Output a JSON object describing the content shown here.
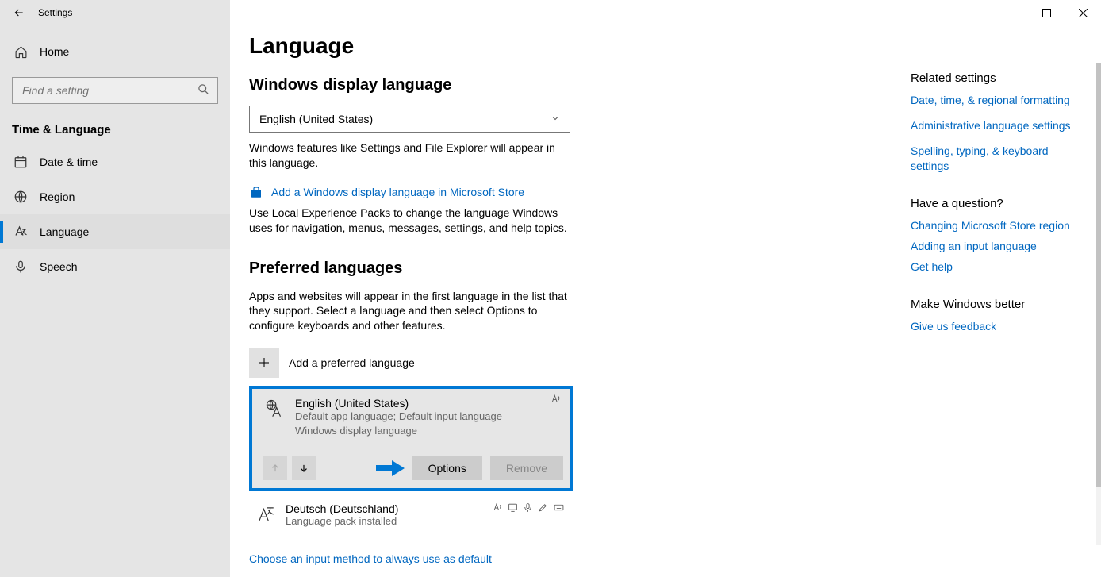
{
  "window": {
    "title": "Settings"
  },
  "sidebar": {
    "home": "Home",
    "search_placeholder": "Find a setting",
    "category": "Time & Language",
    "items": [
      {
        "label": "Date & time"
      },
      {
        "label": "Region"
      },
      {
        "label": "Language"
      },
      {
        "label": "Speech"
      }
    ]
  },
  "main": {
    "page_title": "Language",
    "display_section": {
      "heading": "Windows display language",
      "selected": "English (United States)",
      "desc": "Windows features like Settings and File Explorer will appear in this language.",
      "store_link": "Add a Windows display language in Microsoft Store",
      "store_desc": "Use Local Experience Packs to change the language Windows uses for navigation, menus, messages, settings, and help topics."
    },
    "preferred_section": {
      "heading": "Preferred languages",
      "desc": "Apps and websites will appear in the first language in the list that they support. Select a language and then select Options to configure keyboards and other features.",
      "add_label": "Add a preferred language",
      "items": [
        {
          "name": "English (United States)",
          "sub1": "Default app language; Default input language",
          "sub2": "Windows display language",
          "options_label": "Options",
          "remove_label": "Remove"
        },
        {
          "name": "Deutsch (Deutschland)",
          "sub1": "Language pack installed"
        }
      ],
      "footer_link": "Choose an input method to always use as default"
    }
  },
  "related": {
    "heading1": "Related settings",
    "links1": [
      "Date, time, & regional formatting",
      "Administrative language settings",
      "Spelling, typing, & keyboard settings"
    ],
    "heading2": "Have a question?",
    "links2": [
      "Changing Microsoft Store region",
      "Adding an input language",
      "Get help"
    ],
    "heading3": "Make Windows better",
    "links3": [
      "Give us feedback"
    ]
  }
}
